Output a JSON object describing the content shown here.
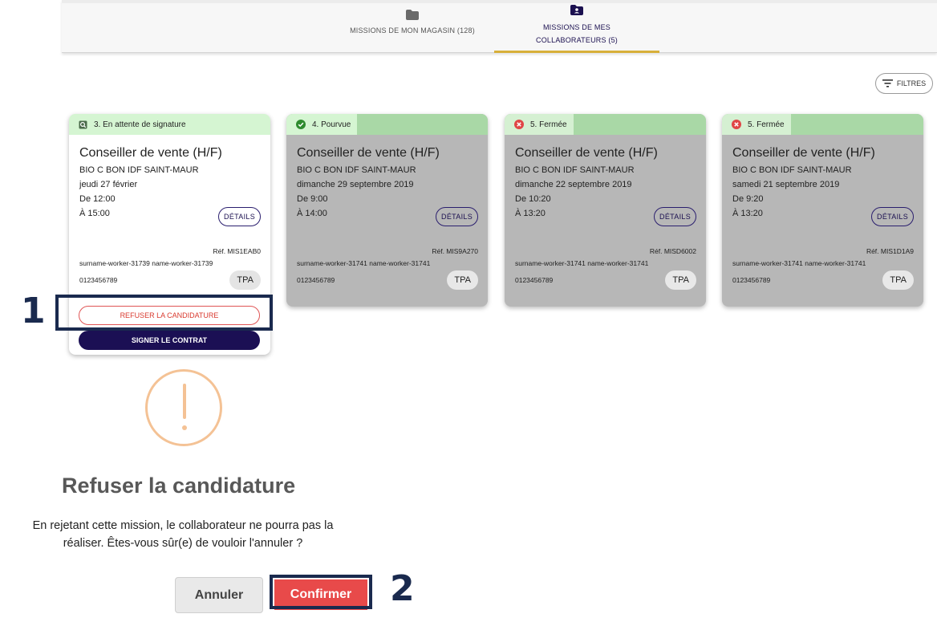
{
  "tabs": [
    {
      "label": "MISSIONS DE MON MAGASIN (128)",
      "icon": "folder-icon"
    },
    {
      "label_line1": "MISSIONS DE MES",
      "label_line2": "COLLABORATEURS (5)",
      "icon": "folder-user-icon"
    }
  ],
  "filters_label": "FILTRES",
  "cards": [
    {
      "status": "3. En attente de signature",
      "status_icon": "pending-signature-icon",
      "title": "Conseiller de vente (H/F)",
      "store": "BIO C BON IDF SAINT-MAUR",
      "date": "jeudi 27 février",
      "from": "De 12:00",
      "to": "À 15:00",
      "details": "DÉTAILS",
      "ref": "Réf. MIS1EAB0",
      "worker": "surname-worker-31739 name-worker-31739",
      "phone": "0123456789",
      "tag": "TPA",
      "refuse_label": "REFUSER LA CANDIDATURE",
      "sign_label": "SIGNER LE CONTRAT"
    },
    {
      "status": "4. Pourvue",
      "status_icon": "check-circle-icon",
      "title": "Conseiller de vente (H/F)",
      "store": "BIO C BON IDF SAINT-MAUR",
      "date": "dimanche 29 septembre 2019",
      "from": "De 9:00",
      "to": "À 14:00",
      "details": "DÉTAILS",
      "ref": "Réf. MIS9A270",
      "worker": "surname-worker-31741 name-worker-31741",
      "phone": "0123456789",
      "tag": "TPA"
    },
    {
      "status": "5. Fermée",
      "status_icon": "x-circle-icon",
      "title": "Conseiller de vente (H/F)",
      "store": "BIO C BON IDF SAINT-MAUR",
      "date": "dimanche 22 septembre 2019",
      "from": "De 10:20",
      "to": "À 13:20",
      "details": "DÉTAILS",
      "ref": "Réf. MISD6002",
      "worker": "surname-worker-31741 name-worker-31741",
      "phone": "0123456789",
      "tag": "TPA"
    },
    {
      "status": "5. Fermée",
      "status_icon": "x-circle-icon",
      "title": "Conseiller de vente (H/F)",
      "store": "BIO C BON IDF SAINT-MAUR",
      "date": "samedi 21 septembre 2019",
      "from": "De 9:20",
      "to": "À 13:20",
      "details": "DÉTAILS",
      "ref": "Réf. MIS1D1A9",
      "worker": "surname-worker-31741 name-worker-31741",
      "phone": "0123456789",
      "tag": "TPA"
    }
  ],
  "annotations": {
    "step1": "1",
    "step2": "2"
  },
  "dialog": {
    "icon": "warning-icon",
    "title": "Refuser la candidature",
    "text_line1": "En rejetant cette mission, le collaborateur ne pourra pas la",
    "text_line2": "réaliser. Êtes-vous sûr(e) de vouloir l'annuler ?",
    "cancel_label": "Annuler",
    "confirm_label": "Confirmer"
  },
  "colors": {
    "primary_navy": "#1b0f54",
    "accent_gold": "#d8b03a",
    "danger_red": "#e84a4a",
    "status_green": "#a9d8a6",
    "warning_orange": "#f4c295",
    "annotation_navy": "#1a2a4e"
  }
}
